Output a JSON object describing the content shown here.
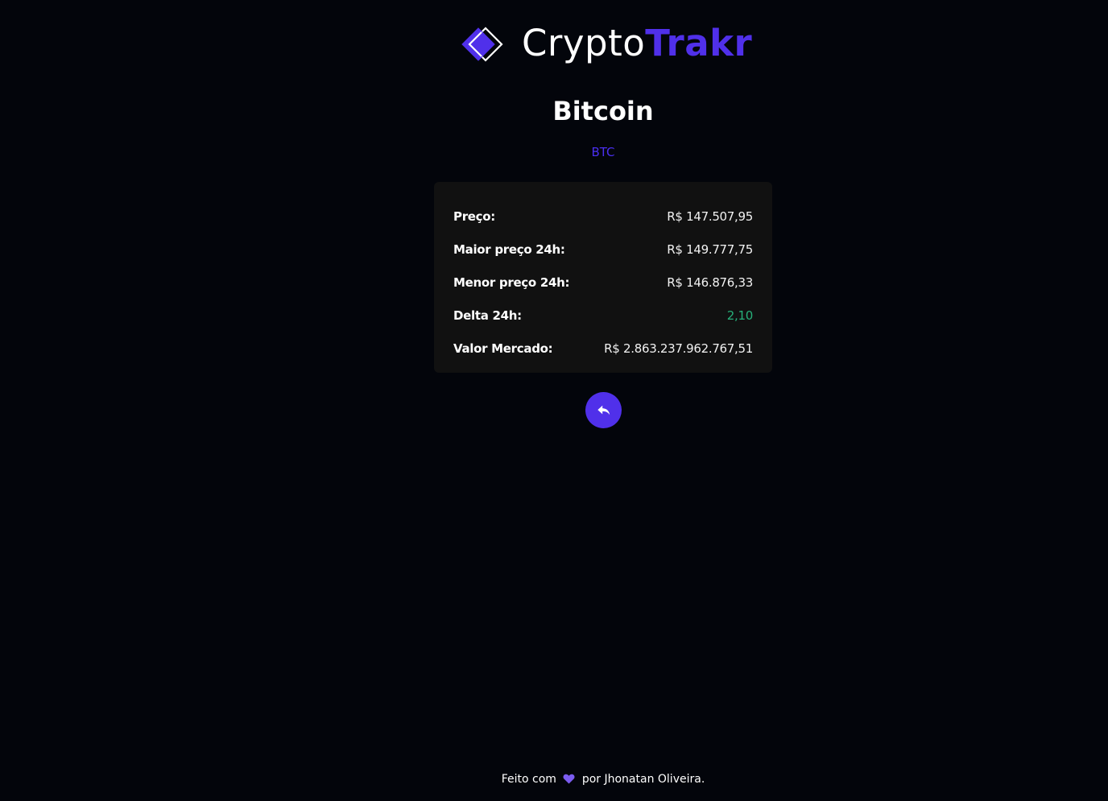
{
  "header": {
    "logo_icon": "diamond-logo-icon",
    "logo_text_part1": "Crypto",
    "logo_text_part2": "Trakr"
  },
  "coin": {
    "name": "Bitcoin",
    "symbol": "BTC"
  },
  "stats": [
    {
      "label": "Preço:",
      "value": "R$ 147.507,95"
    },
    {
      "label": "Maior preço 24h:",
      "value": "R$ 149.777,75"
    },
    {
      "label": "Menor preço 24h:",
      "value": "R$ 146.876,33"
    },
    {
      "label": "Delta 24h:",
      "value": "2,10",
      "status": "positive"
    },
    {
      "label": "Valor Mercado:",
      "value": "R$ 2.863.237.962.767,51"
    }
  ],
  "back_button": {
    "icon": "reply-arrow-icon"
  },
  "footer": {
    "text_before": "Feito com",
    "heart_icon": "heart-icon",
    "text_after": "por Jhonatan Oliveira."
  },
  "colors": {
    "background": "#03050b",
    "accent": "#5030ea",
    "card": "#111111",
    "positive": "#27b07a",
    "heart": "#7b5cf0"
  }
}
